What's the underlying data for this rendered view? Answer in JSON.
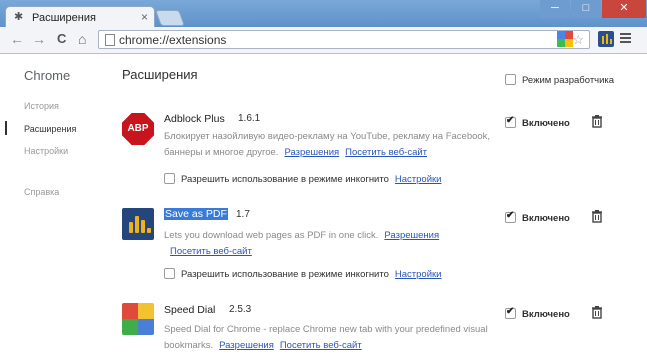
{
  "window": {
    "tab_title": "Расширения",
    "tab_close": "×",
    "url": "chrome://extensions",
    "min": "─",
    "max": "□",
    "close": "✕"
  },
  "nav": {
    "back": "←",
    "forward": "→",
    "reload": "C",
    "star": "☆"
  },
  "sidebar": {
    "title": "Chrome",
    "items": [
      {
        "label": "История"
      },
      {
        "label": "Расширения"
      },
      {
        "label": "Настройки"
      },
      {
        "label": "Справка"
      }
    ]
  },
  "main": {
    "title": "Расширения",
    "dev_mode": "Режим разработчика"
  },
  "extensions": [
    {
      "name": "Adblock Plus",
      "version": "1.6.1",
      "icon_text": "ABP",
      "description": "Блокирует назойливую видео-рекламу на YouTube, рекламу на Facebook, баннеры и многое другое.",
      "perm_link": "Разрешения",
      "site_link": "Посетить веб-сайт",
      "incognito_label": "Разрешить использование в режиме инкогнито",
      "settings_link": "Настройки",
      "enabled_label": "Включено",
      "enabled": true
    },
    {
      "name": "Save as PDF",
      "version": "1.7",
      "description": "Lets you download web pages as PDF in one click.",
      "perm_link": "Разрешения",
      "site_link": "Посетить веб-сайт",
      "incognito_label": "Разрешить использование в режиме инкогнито",
      "settings_link": "Настройки",
      "enabled_label": "Включено",
      "enabled": true
    },
    {
      "name": "Speed Dial",
      "version": "2.5.3",
      "description": "Speed Dial for Chrome - replace Chrome new tab with your predefined visual bookmarks.",
      "perm_link": "Разрешения",
      "site_link": "Посетить веб-сайт",
      "enabled_label": "Включено",
      "enabled": true
    }
  ],
  "colors": {
    "link": "#2a55b8",
    "abp_red": "#c8141c",
    "pdf_blue": "#25457d"
  }
}
